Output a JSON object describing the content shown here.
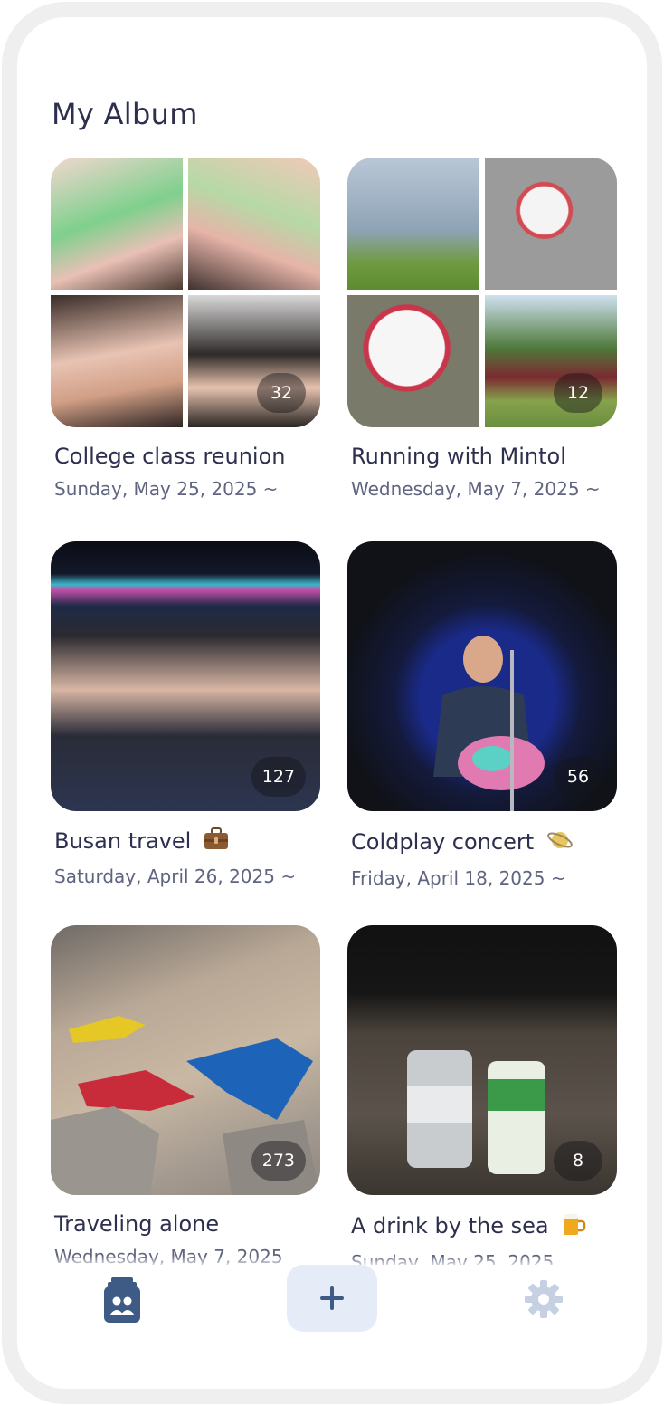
{
  "page": {
    "title": "My Album"
  },
  "albums": [
    {
      "name": "College class reunion",
      "date": "Sunday, May 25, 2025 ~",
      "count": "32",
      "emoji": ""
    },
    {
      "name": "Running with Mintol",
      "date": "Wednesday, May 7, 2025 ~",
      "count": "12",
      "emoji": ""
    },
    {
      "name": "Busan travel",
      "date": "Saturday, April 26, 2025 ~",
      "count": "127",
      "emoji": "suitcase-icon"
    },
    {
      "name": "Coldplay concert",
      "date": "Friday, April 18, 2025 ~",
      "count": "56",
      "emoji": "planet-icon"
    },
    {
      "name": "Traveling alone",
      "date": "Wednesday, May 7, 2025",
      "count": "273",
      "emoji": ""
    },
    {
      "name": "A drink by the sea",
      "date": "Sunday, May 25, 2025",
      "count": "8",
      "emoji": "beer-mug-icon"
    }
  ],
  "tabbar": {
    "items": [
      "albums-tab-icon",
      "add-button-plus-icon",
      "settings-gear-icon"
    ],
    "active_color": "#3e5b86",
    "inactive_color": "#c5d1e3"
  }
}
